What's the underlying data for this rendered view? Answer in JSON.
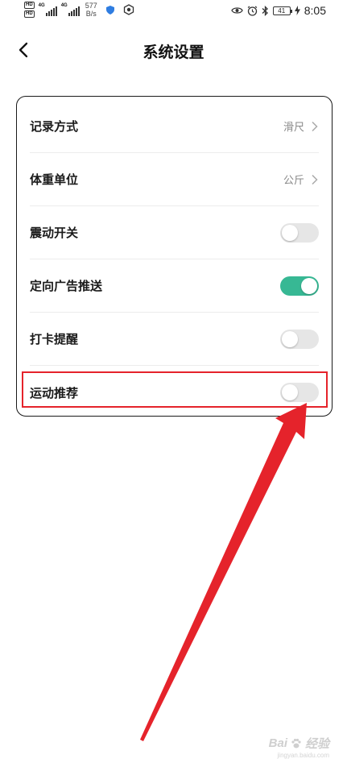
{
  "status_bar": {
    "hd1": "HD",
    "hd2": "HD",
    "net1": "4G",
    "net2": "4G",
    "speed_value": "577",
    "speed_unit": "B/s",
    "battery": "41",
    "time": "8:05"
  },
  "header": {
    "title": "系统设置"
  },
  "settings": [
    {
      "label": "记录方式",
      "value": "滑尺"
    },
    {
      "label": "体重单位",
      "value": "公斤"
    },
    {
      "label": "震动开关",
      "on": false
    },
    {
      "label": "定向广告推送",
      "on": true
    },
    {
      "label": "打卡提醒",
      "on": false
    },
    {
      "label": "运动推荐",
      "on": false
    }
  ],
  "colors": {
    "accent": "#37b894",
    "highlight": "#e5232b"
  },
  "watermark": {
    "brand": "Bai",
    "suffix": "经验",
    "site": "jingyan.baidu.com"
  }
}
